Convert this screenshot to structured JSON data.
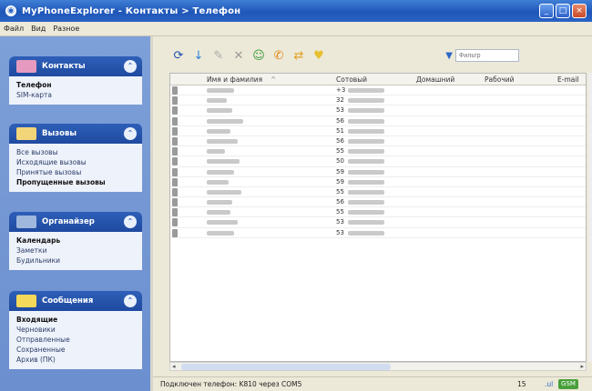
{
  "window": {
    "title": "MyPhoneExplorer - Контакты > Телефон",
    "controls": [
      "minimize",
      "maximize",
      "close"
    ]
  },
  "menu": {
    "items": [
      "Файл",
      "Вид",
      "Разное"
    ]
  },
  "sidebar": {
    "groups": [
      {
        "title": "Контакты",
        "icon": "contacts-icon",
        "items": [
          {
            "label": "Телефон",
            "bold": true
          },
          {
            "label": "SIM-карта",
            "bold": false
          }
        ]
      },
      {
        "title": "Вызовы",
        "icon": "calls-icon",
        "items": [
          {
            "label": "Все вызовы",
            "bold": false
          },
          {
            "label": "Исходящие вызовы",
            "bold": false
          },
          {
            "label": "Принятые вызовы",
            "bold": false
          },
          {
            "label": "Пропущенные вызовы",
            "bold": true
          }
        ]
      },
      {
        "title": "Органайзер",
        "icon": "organizer-icon",
        "items": [
          {
            "label": "Календарь",
            "bold": true
          },
          {
            "label": "Заметки",
            "bold": false
          },
          {
            "label": "Будильники",
            "bold": false
          }
        ]
      },
      {
        "title": "Сообщения",
        "icon": "messages-icon",
        "items": [
          {
            "label": "Входящие",
            "bold": true
          },
          {
            "label": "Черновики",
            "bold": false
          },
          {
            "label": "Отправленные",
            "bold": false
          },
          {
            "label": "Сохраненные",
            "bold": false
          },
          {
            "label": "Архив (ПК)",
            "bold": false
          }
        ]
      }
    ]
  },
  "toolbar": {
    "icons": [
      "refresh-icon",
      "download-icon",
      "edit-icon",
      "delete-icon",
      "add-contact-icon",
      "call-icon",
      "sync-icon",
      "favorite-icon"
    ],
    "filter_placeholder": "Фильтр"
  },
  "grid": {
    "columns": [
      "Имя и фамилия",
      "Сотовый",
      "Домашний",
      "Рабочий",
      "E-mail"
    ],
    "phone_prefixes": [
      "+3",
      "32",
      "53",
      "56",
      "51",
      "56",
      "55",
      "50",
      "59",
      "59",
      "55",
      "56",
      "55",
      "53",
      "53"
    ]
  },
  "status": {
    "text": "Подключен телефон: K810 через COM5",
    "count": "15",
    "zoom": ".ul",
    "badge": "GSM"
  }
}
